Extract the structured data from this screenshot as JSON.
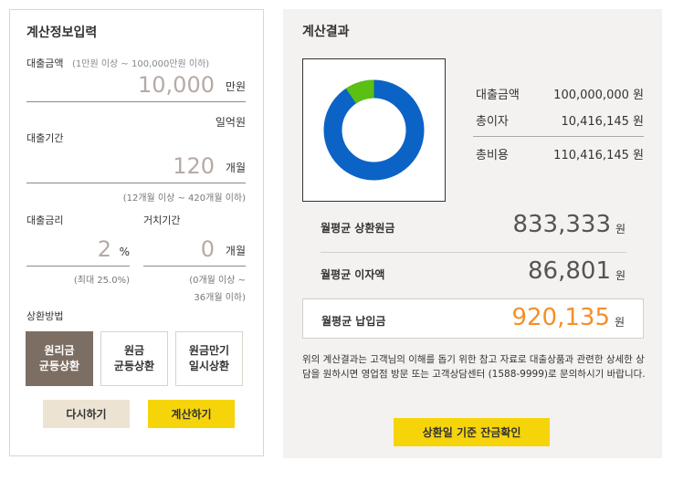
{
  "input_panel": {
    "title": "계산정보입력",
    "loan_amount": {
      "label": "대출금액",
      "range_hint": "(1만원 이상 ~ 100,000만원 이하)",
      "value": "10,000",
      "unit": "만원",
      "reading": "일억원"
    },
    "loan_period": {
      "label": "대출기간",
      "value": "120",
      "unit": "개월",
      "range_hint": "(12개월 이상 ~ 420개월 이하)"
    },
    "interest_rate": {
      "label": "대출금리",
      "value": "2",
      "unit": "%",
      "hint": "(최대 25.0%)"
    },
    "grace_period": {
      "label": "거치기간",
      "value": "0",
      "unit": "개월",
      "hint_line1": "(0개월 이상 ~",
      "hint_line2": "36개월 이하)"
    },
    "repayment": {
      "label": "상환방법",
      "options": [
        "원리금\n균등상환",
        "원금\n균등상환",
        "원금만기\n일시상환"
      ],
      "selected_index": 0
    },
    "reset_label": "다시하기",
    "calc_label": "계산하기"
  },
  "result_panel": {
    "title": "계산결과",
    "donut": {
      "principal_fraction": 0.9057,
      "interest_fraction": 0.0943,
      "principal_color": "#0b63c6",
      "interest_color": "#5cbf14"
    },
    "summary": [
      {
        "label": "대출금액",
        "value": "100,000,000",
        "unit": "원"
      },
      {
        "label": "총이자",
        "value": "10,416,145",
        "unit": "원"
      },
      {
        "label": "총비용",
        "value": "110,416,145",
        "unit": "원"
      }
    ],
    "monthly_principal": {
      "label": "월평균 상환원금",
      "value": "833,333",
      "unit": "원"
    },
    "monthly_interest": {
      "label": "월평균 이자액",
      "value": "86,801",
      "unit": "원"
    },
    "monthly_total": {
      "label": "월평균 납입금",
      "value": "920,135",
      "unit": "원",
      "color": "#f58f2a"
    },
    "note": "위의 계산결과는 고객님의 이해를 돕기 위한 참고 자료로 대출상품과 관련한 상세한 상담을 원하시면 영업점 방문 또는 고객상담센터 (1588-9999)로 문의하시기 바랍니다.",
    "balance_button": "상환일 기준 잔금확인"
  }
}
